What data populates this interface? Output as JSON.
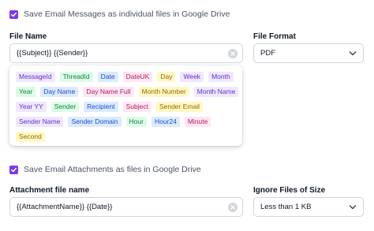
{
  "save_messages": {
    "label": "Save Email Messages as individual files in Google Drive",
    "checked": true
  },
  "file_name": {
    "label": "File Name",
    "value": "{{Subject}} {{Sender}}"
  },
  "file_format": {
    "label": "File Format",
    "value": "PDF"
  },
  "tokens": [
    [
      {
        "text": "MessageId",
        "color": "purple"
      },
      {
        "text": "ThreadId",
        "color": "green"
      },
      {
        "text": "Date",
        "color": "blue"
      },
      {
        "text": "DateUK",
        "color": "pink"
      },
      {
        "text": "Day",
        "color": "yellow"
      },
      {
        "text": "Week",
        "color": "purple"
      },
      {
        "text": "Month",
        "color": "purple"
      }
    ],
    [
      {
        "text": "Year",
        "color": "green"
      },
      {
        "text": "Day Name",
        "color": "blue"
      },
      {
        "text": "Day Name Full",
        "color": "pink"
      },
      {
        "text": "Month Number",
        "color": "yellow"
      },
      {
        "text": "Month Name",
        "color": "purple"
      }
    ],
    [
      {
        "text": "Year YY",
        "color": "purple"
      },
      {
        "text": "Sender",
        "color": "green"
      },
      {
        "text": "Recipient",
        "color": "blue"
      },
      {
        "text": "Subject",
        "color": "pink"
      },
      {
        "text": "Sender Email",
        "color": "yellow"
      }
    ],
    [
      {
        "text": "Sender Name",
        "color": "purple"
      },
      {
        "text": "Sender Domain",
        "color": "blue"
      },
      {
        "text": "Hour",
        "color": "green"
      },
      {
        "text": "Hour24",
        "color": "blue"
      },
      {
        "text": "Minute",
        "color": "pink"
      }
    ],
    [
      {
        "text": "Second",
        "color": "yellow"
      }
    ]
  ],
  "save_attachments": {
    "label": "Save Email Attachments as files in Google Drive",
    "checked": true
  },
  "attachment_name": {
    "label": "Attachment file name",
    "value": "{{AttachmentName}} {{Date}}"
  },
  "ignore_size": {
    "label": "Ignore Files of Size",
    "value": "Less than 1 KB"
  },
  "colors": {
    "accent": "#7c3aed",
    "border": "#d1d5db"
  }
}
